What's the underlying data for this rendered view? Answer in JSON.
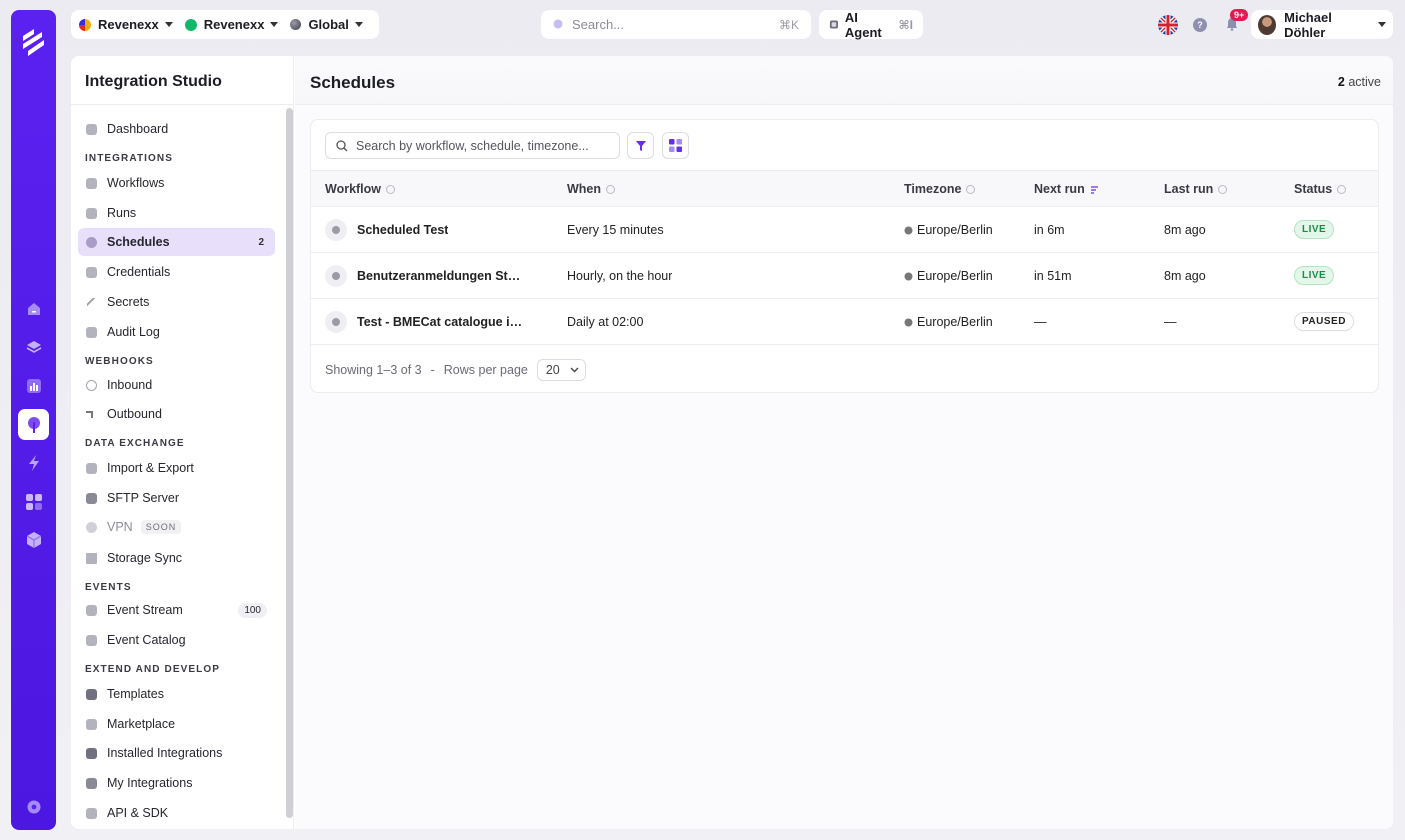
{
  "topbar": {
    "contexts": [
      {
        "label": "Revenexx",
        "dot_color": "#f0b000"
      },
      {
        "label": "Revenexx",
        "dot_color": "#12b76a"
      },
      {
        "label": "Global",
        "dot_color": "#6b6b78"
      }
    ],
    "search_placeholder": "Search...",
    "search_shortcut": "⌘K",
    "ai_label": "AI Agent",
    "ai_shortcut": "⌘I",
    "notifications_badge": "9+",
    "user_name": "Michael Döhler"
  },
  "sidebar": {
    "title": "Integration Studio",
    "items": [
      {
        "label": "Dashboard"
      },
      {
        "section": "INTEGRATIONS"
      },
      {
        "label": "Workflows"
      },
      {
        "label": "Runs"
      },
      {
        "label": "Schedules",
        "count": "2",
        "active": true
      },
      {
        "label": "Credentials"
      },
      {
        "label": "Secrets"
      },
      {
        "label": "Audit Log"
      },
      {
        "section": "WEBHOOKS"
      },
      {
        "label": "Inbound"
      },
      {
        "label": "Outbound"
      },
      {
        "section": "DATA EXCHANGE"
      },
      {
        "label": "Import & Export"
      },
      {
        "label": "SFTP Server"
      },
      {
        "label": "VPN",
        "tag": "SOON"
      },
      {
        "label": "Storage Sync"
      },
      {
        "section": "EVENTS"
      },
      {
        "label": "Event Stream",
        "count": "100"
      },
      {
        "label": "Event Catalog"
      },
      {
        "section": "EXTEND AND DEVELOP"
      },
      {
        "label": "Templates"
      },
      {
        "label": "Marketplace"
      },
      {
        "label": "Installed Integrations"
      },
      {
        "label": "My Integrations"
      },
      {
        "label": "API & SDK"
      }
    ]
  },
  "main": {
    "title": "Schedules",
    "active_count": "2",
    "active_label": "active",
    "table_search_placeholder": "Search by workflow, schedule, timezone...",
    "columns": [
      "Workflow",
      "When",
      "Timezone",
      "Next run",
      "Last run",
      "Status"
    ],
    "rows": [
      {
        "workflow": "Scheduled Test",
        "when": "Every 15 minutes",
        "timezone": "Europe/Berlin",
        "next_run": "in 6m",
        "last_run": "8m ago",
        "status": "LIVE"
      },
      {
        "workflow": "Benutzeranmeldungen Stündlich - ...",
        "when": "Hourly, on the hour",
        "timezone": "Europe/Berlin",
        "next_run": "in 51m",
        "last_run": "8m ago",
        "status": "LIVE"
      },
      {
        "workflow": "Test - BMECat catalogue import fr...",
        "when": "Daily at 02:00",
        "timezone": "Europe/Berlin",
        "next_run": "—",
        "last_run": "—",
        "status": "PAUSED"
      }
    ],
    "footer": {
      "showing": "Showing 1–3 of 3",
      "separator": "-",
      "rows_per_page_label": "Rows per page",
      "rows_per_page": "20"
    }
  },
  "colors": {
    "brand": "#5b21f0",
    "live": "#1f8a45",
    "badge": "#e5184f"
  }
}
